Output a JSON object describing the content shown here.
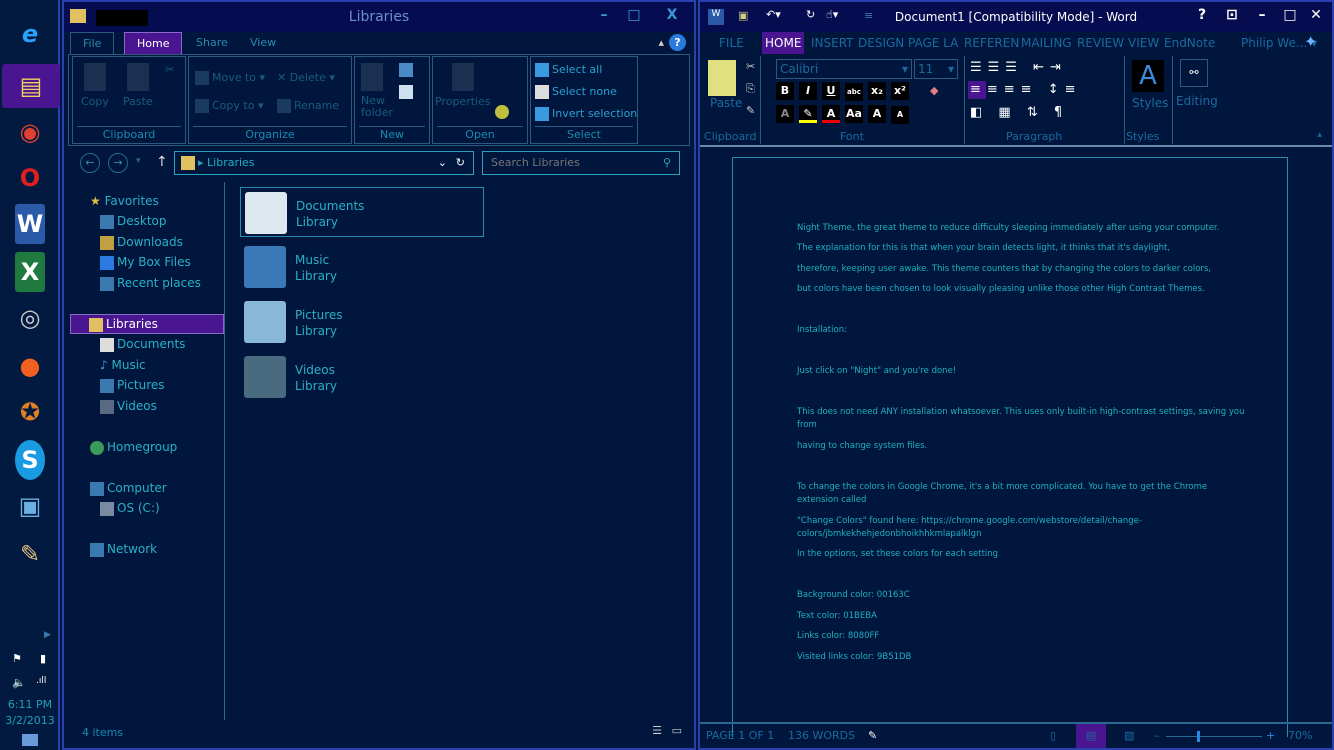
{
  "taskbar": {
    "apps": [
      "internet-explorer",
      "file-explorer",
      "chrome",
      "opera",
      "word",
      "excel",
      "steam",
      "origin",
      "swtor",
      "skype",
      "remote-desktop",
      "paint"
    ],
    "time": "6:11 PM",
    "date": "3/2/2013"
  },
  "explorer": {
    "title": "Libraries",
    "tabs": [
      "File",
      "Home",
      "Share",
      "View"
    ],
    "ribbon": {
      "copy": "Copy",
      "paste": "Paste",
      "clipboard": "Clipboard",
      "move_to": "Move to",
      "copy_to": "Copy to",
      "delete": "Delete",
      "rename": "Rename",
      "organize": "Organize",
      "new_folder_1": "New",
      "new_folder_2": "folder",
      "new": "New",
      "properties": "Properties",
      "open": "Open",
      "select_all": "Select all",
      "select_none": "Select none",
      "invert_selection": "Invert selection",
      "select": "Select"
    },
    "address": "Libraries",
    "search_placeholder": "Search Libraries",
    "nav": {
      "favorites": "Favorites",
      "desktop": "Desktop",
      "downloads": "Downloads",
      "mybox": "My Box Files",
      "recent": "Recent places",
      "libraries": "Libraries",
      "documents": "Documents",
      "music": "Music",
      "pictures": "Pictures",
      "videos": "Videos",
      "homegroup": "Homegroup",
      "computer": "Computer",
      "osc": "OS (C:)",
      "network": "Network"
    },
    "libraries": [
      {
        "name": "Documents",
        "type": "Library"
      },
      {
        "name": "Music",
        "type": "Library"
      },
      {
        "name": "Pictures",
        "type": "Library"
      },
      {
        "name": "Videos",
        "type": "Library"
      }
    ],
    "status": "4 items"
  },
  "word": {
    "title": "Document1 [Compatibility Mode] - Word",
    "tabs": [
      "FILE",
      "HOME",
      "INSERT",
      "DESIGN",
      "PAGE LA",
      "REFEREN",
      "MAILING",
      "REVIEW",
      "VIEW",
      "EndNote"
    ],
    "user": "Philip We...",
    "ribbon": {
      "paste": "Paste",
      "clipboard": "Clipboard",
      "font_name": "Calibri",
      "font_size": "11",
      "font": "Font",
      "paragraph": "Paragraph",
      "styles_btn": "Styles",
      "styles": "Styles",
      "editing": "Editing"
    },
    "document": [
      "Night Theme, the great theme to reduce difficulty sleeping immediately after using your computer.",
      "The explanation for this is that when your brain detects light, it thinks that it's daylight,",
      "therefore, keeping user awake. This theme counters that by changing the colors to darker colors,",
      "but colors have been chosen to look visually pleasing unlike those other High Contrast Themes.",
      "Installation:",
      "Just click on \"Night\" and you're done!",
      "This does not need ANY installation whatsoever. This uses only built-in high-contrast settings, saving you",
      "from",
      "having to change system files.",
      "To change the colors in Google Chrome, it's a bit more complicated. You have to get the Chrome",
      "extension called",
      "\"Change Colors\" found here: https://chrome.google.com/webstore/detail/change-",
      "colors/jbmkekhehjedonbhoikhhkmlapalklgn",
      "In the options, set these colors for each setting",
      "Background color: 00163C",
      "Text color: 01BEBA",
      "Links color: 8080FF",
      "Visited links color: 9B51DB"
    ],
    "status": {
      "page": "PAGE 1 OF 1",
      "words": "136 WORDS",
      "zoom": "70%",
      "zoom_percent": 70
    }
  },
  "colors": {
    "background": "#01163c",
    "text": "#1fb0c4",
    "accent": "#4a1590",
    "border": "#2a3fb0"
  }
}
